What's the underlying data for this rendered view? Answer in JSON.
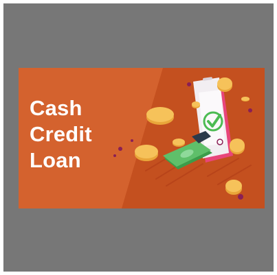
{
  "banner": {
    "lines": [
      "Cash",
      "Credit",
      "Loan"
    ]
  },
  "colors": {
    "background_outer": "#777777",
    "banner_orange": "#d4622e",
    "banner_dark_orange": "#c4501f",
    "text": "#ffffff",
    "phone_body": "#f2eef2",
    "phone_edge": "#e8457a",
    "check_green": "#4cbb53",
    "cash_green": "#5fbf6a",
    "coin_gold": "#f6c25a"
  },
  "icons": [
    "smartphone-icon",
    "checkmark-icon",
    "banknote-icon",
    "coin-icon"
  ]
}
